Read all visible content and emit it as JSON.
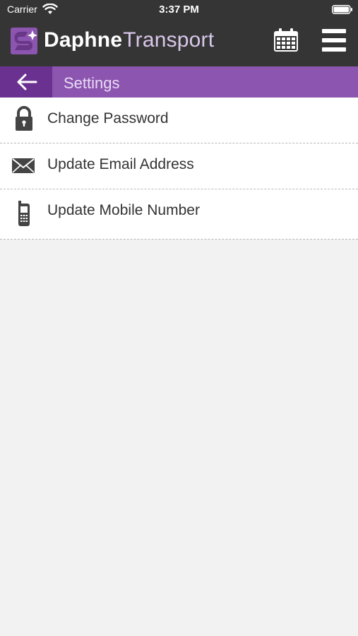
{
  "status_bar": {
    "carrier": "Carrier",
    "time": "3:37 PM",
    "wifi_icon": "wifi-icon",
    "battery_icon": "battery-icon"
  },
  "header": {
    "brand_bold": "Daphne",
    "brand_light": "Transport",
    "logo_icon": "logo-mark",
    "calendar_icon": "calendar-icon",
    "menu_icon": "hamburger-menu-icon"
  },
  "title_bar": {
    "back_icon": "arrow-left-icon",
    "title": "Settings"
  },
  "settings": {
    "items": [
      {
        "label": "Change Password",
        "icon": "lock-icon"
      },
      {
        "label": "Update Email Address",
        "icon": "envelope-icon"
      },
      {
        "label": "Update Mobile Number",
        "icon": "mobile-phone-icon"
      }
    ]
  },
  "colors": {
    "header_bg": "#353535",
    "title_bar_bg": "#8c55b0",
    "back_button_bg": "#6b3190",
    "page_bg": "#f2f2f2",
    "list_bg": "#ffffff"
  }
}
